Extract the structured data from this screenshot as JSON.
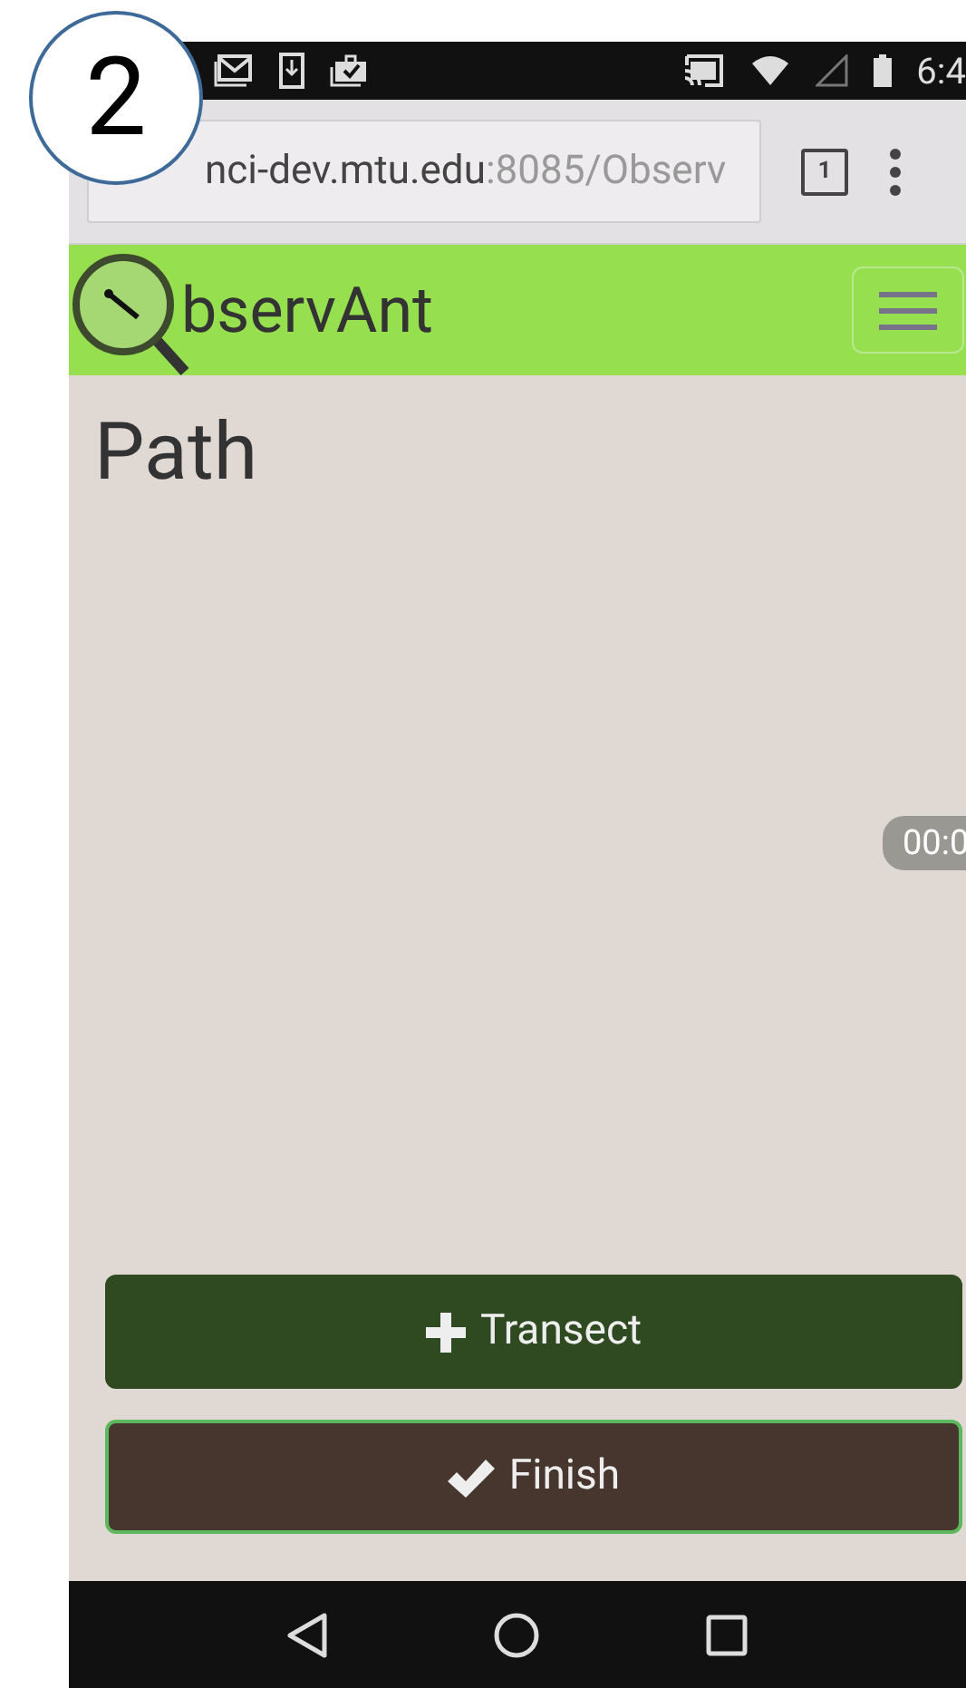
{
  "figure_label": "2",
  "status_bar": {
    "time": "6:4"
  },
  "browser": {
    "url_host": "nci-dev.mtu.edu",
    "url_rest": ":8085/Observ",
    "tab_count": "1"
  },
  "navbar": {
    "brand": "bservAnt",
    "menu_expanded": false
  },
  "page": {
    "title": "Path",
    "timer": "00:0"
  },
  "buttons": [
    {
      "kind": "add",
      "label": "Transect"
    },
    {
      "kind": "finish",
      "label": "Finish"
    }
  ]
}
